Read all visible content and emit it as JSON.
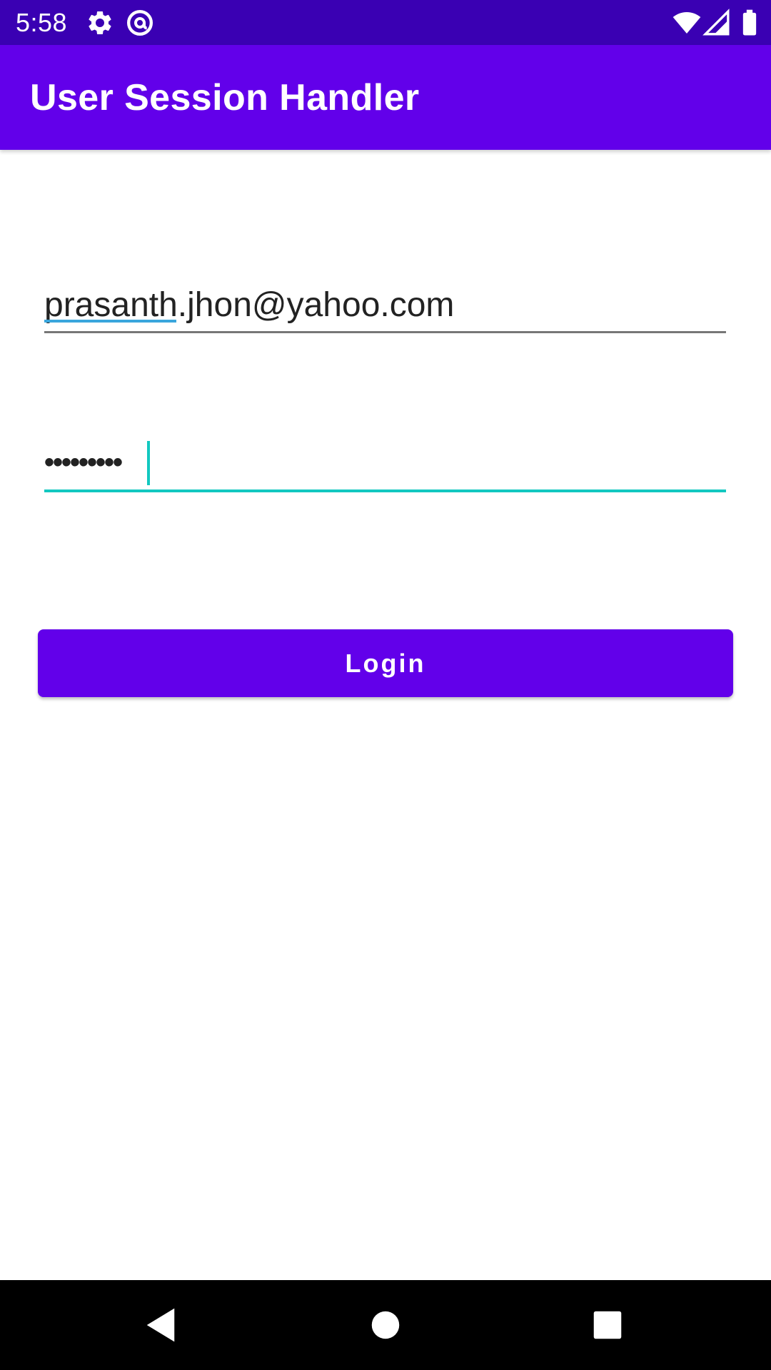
{
  "status_bar": {
    "time": "5:58",
    "icons": [
      "gear-icon",
      "at-sign-icon",
      "wifi-icon",
      "signal-icon",
      "battery-icon"
    ]
  },
  "app_bar": {
    "title": "User Session Handler",
    "background": "#6200ea"
  },
  "form": {
    "email_value": "prasanth.jhon@yahoo.com",
    "password_value": "•••••••••",
    "login_label": "Login"
  },
  "colors": {
    "status_bar": "#3a00b3",
    "primary": "#6200ea",
    "accent": "#12c8c0"
  },
  "nav_bar": {
    "icons": [
      "back-icon",
      "home-icon",
      "recents-icon"
    ]
  }
}
